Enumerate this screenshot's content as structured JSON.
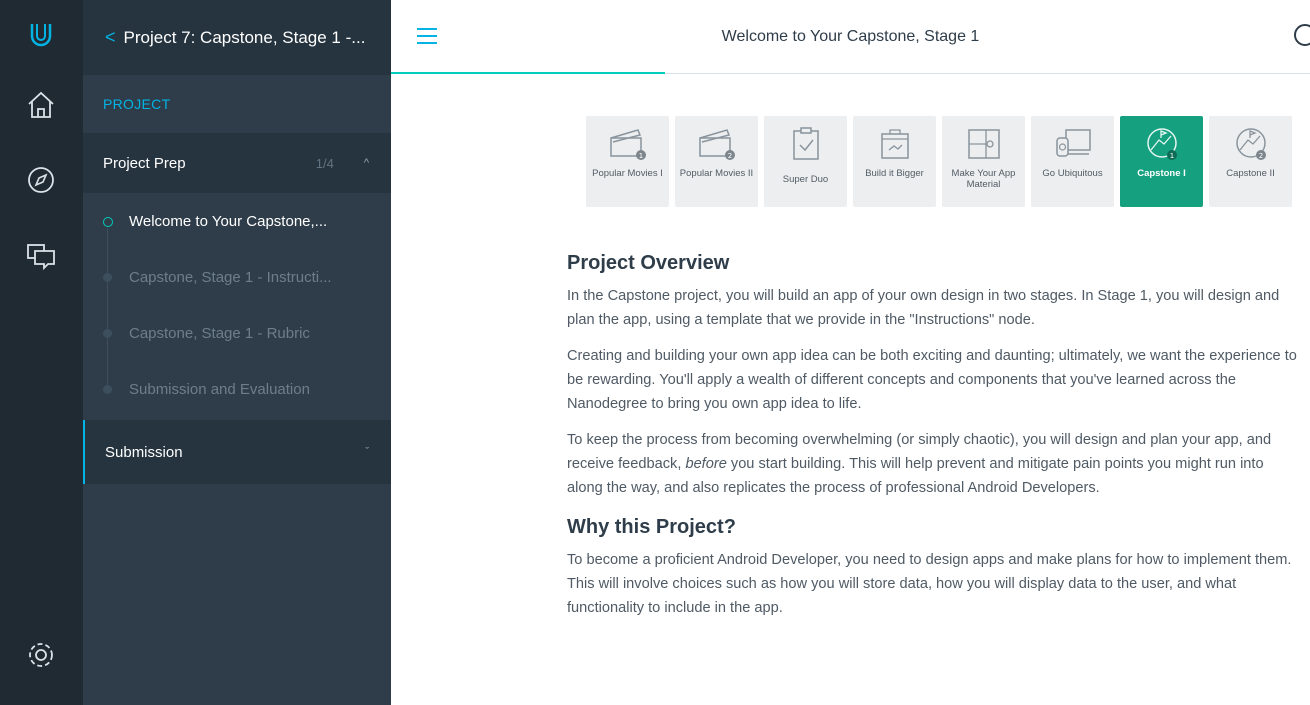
{
  "colors": {
    "rail": "#1f2a33",
    "sidebar": "#2e3d49",
    "accent": "#02b3e4",
    "teal": "#02ccba",
    "active_tile": "#15a080"
  },
  "rail": {
    "icons": [
      "udacity-logo-icon",
      "home-icon",
      "compass-icon",
      "chat-icon",
      "gear-icon"
    ]
  },
  "sidebar": {
    "back_title": "Project 7: Capstone, Stage 1 -...",
    "section_label": "PROJECT",
    "group": {
      "label": "Project Prep",
      "count": "1/4",
      "caret": "^"
    },
    "steps": [
      {
        "label": "Welcome to Your Capstone,..."
      },
      {
        "label": "Capstone, Stage 1 - Instructi..."
      },
      {
        "label": "Capstone, Stage 1 - Rubric"
      },
      {
        "label": "Submission and Evaluation"
      }
    ],
    "submission": {
      "label": "Submission",
      "caret": "ˇ"
    }
  },
  "topbar": {
    "title": "Welcome to Your Capstone, Stage 1"
  },
  "tiles": [
    {
      "label": "Popular Movies I",
      "num": "1"
    },
    {
      "label": "Popular Movies II",
      "num": "2"
    },
    {
      "label": "Super Duo"
    },
    {
      "label": "Build it Bigger"
    },
    {
      "label": "Make Your App Material"
    },
    {
      "label": "Go Ubiquitous"
    },
    {
      "label": "Capstone I",
      "num": "1"
    },
    {
      "label": "Capstone II",
      "num": "2"
    }
  ],
  "content": {
    "h1": "Project Overview",
    "p1": "In the Capstone project, you will build an app of your own design in two stages. In Stage 1, you will design and plan the app, using a template that we provide in the \"Instructions\" node.",
    "p2": "Creating and building your own app idea can be both exciting and daunting; ultimately, we want the experience to be rewarding. You'll apply a wealth of different concepts and components that you've learned across the Nanodegree to bring you own app idea to life.",
    "p3_a": "To keep the process from becoming overwhelming (or simply chaotic), you will design and plan your app, and receive feedback, ",
    "p3_em": "before",
    "p3_b": " you start building. This will help prevent and mitigate pain points you might run into along the way, and also replicates the process of professional Android Developers.",
    "h2": "Why this Project?",
    "p4": "To become a proficient Android Developer, you need to design apps and make plans for how to implement them. This will involve choices such as how you will store data, how you will display data to the user, and what functionality to include in the app."
  }
}
